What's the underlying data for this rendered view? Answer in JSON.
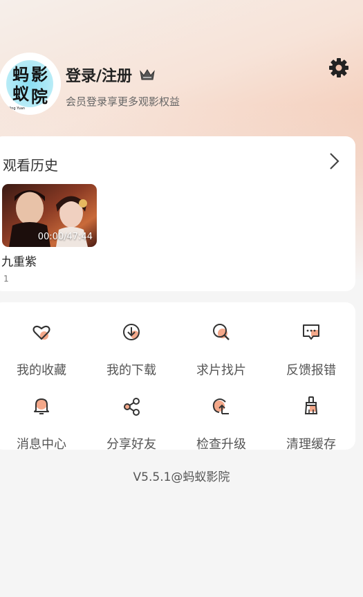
{
  "user": {
    "avatar_text": "蚂蚁影院",
    "avatar_sub": "Ma Yi Ying Yuan",
    "login_label": "登录/注册",
    "subtitle": "会员登录享更多观影权益"
  },
  "history": {
    "title": "观看历史",
    "items": [
      {
        "time": "00:00/47:44",
        "name": "九重紫",
        "episode": "1"
      }
    ]
  },
  "menu": {
    "items": [
      {
        "label": "我的收藏",
        "icon": "heart-icon"
      },
      {
        "label": "我的下载",
        "icon": "download-icon"
      },
      {
        "label": "求片找片",
        "icon": "search-icon"
      },
      {
        "label": "反馈报错",
        "icon": "feedback-icon"
      },
      {
        "label": "消息中心",
        "icon": "bell-icon"
      },
      {
        "label": "分享好友",
        "icon": "share-icon"
      },
      {
        "label": "检查升级",
        "icon": "upgrade-icon"
      },
      {
        "label": "清理缓存",
        "icon": "broom-icon"
      }
    ]
  },
  "footer": {
    "version": "V5.5.1@蚂蚁影院"
  },
  "colors": {
    "accent": "#f4a88a",
    "icon_stroke": "#333333"
  }
}
